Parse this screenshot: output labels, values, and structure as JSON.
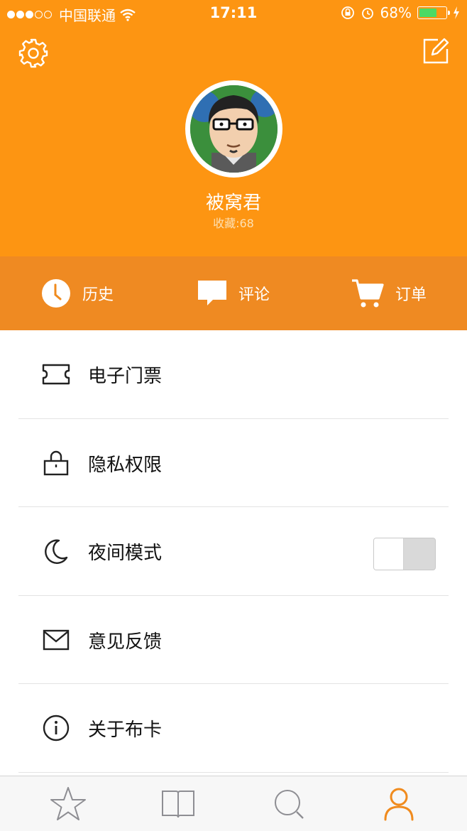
{
  "status_bar": {
    "carrier": "中国联通",
    "time": "17:11",
    "battery": "68%"
  },
  "profile": {
    "username": "被窝君",
    "favorites": "收藏:68"
  },
  "actions": [
    {
      "label": "历史",
      "icon": "clock-icon"
    },
    {
      "label": "评论",
      "icon": "comment-icon"
    },
    {
      "label": "订单",
      "icon": "cart-icon"
    }
  ],
  "menu": [
    {
      "label": "电子门票",
      "icon": "ticket-icon"
    },
    {
      "label": "隐私权限",
      "icon": "lock-icon"
    },
    {
      "label": "夜间模式",
      "icon": "moon-icon"
    },
    {
      "label": "意见反馈",
      "icon": "mail-icon"
    },
    {
      "label": "关于布卡",
      "icon": "info-icon"
    }
  ],
  "night_mode_on": false,
  "tabs": [
    {
      "icon": "star-icon"
    },
    {
      "icon": "book-icon"
    },
    {
      "icon": "search-icon"
    },
    {
      "icon": "user-icon",
      "active": true
    }
  ],
  "colors": {
    "header": "#fd9512",
    "action_bar": "#ef8a22",
    "accent": "#f08b1e",
    "battery_fill": "#4cd964"
  }
}
